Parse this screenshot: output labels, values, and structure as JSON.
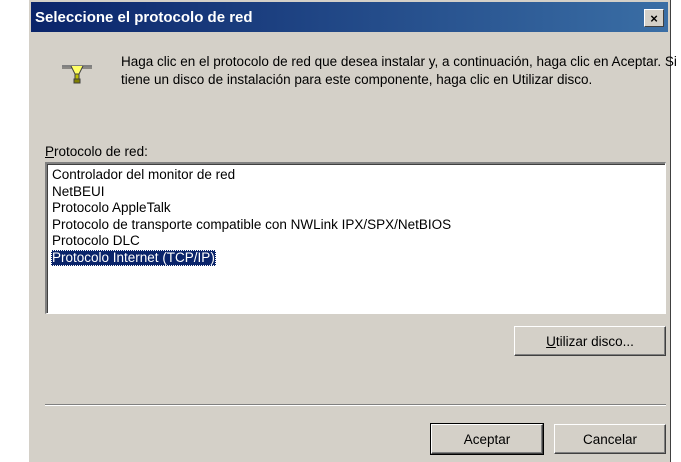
{
  "dialog": {
    "title": "Seleccione el protocolo de red",
    "close_label": "×",
    "instructions": "Haga clic en el protocolo de red que desea instalar y, a continuación, haga clic en Aceptar. Si tiene un disco de instalación para este componente, haga clic en Utilizar disco."
  },
  "list": {
    "label_first": "P",
    "label_rest": "rotocolo de red:",
    "items": [
      "Controlador del monitor de red",
      "NetBEUI",
      "Protocolo AppleTalk",
      "Protocolo de transporte compatible con NWLink IPX/SPX/NetBIOS",
      "Protocolo DLC",
      "Protocolo Internet (TCP/IP)"
    ],
    "selected_index": 5
  },
  "buttons": {
    "disk_first": "U",
    "disk_rest": "tilizar disco...",
    "ok": "Aceptar",
    "cancel": "Cancelar"
  },
  "colors": {
    "titlebar_start": "#0a246a",
    "titlebar_end": "#3a6ea5",
    "face": "#d4d0c8",
    "selection": "#0a246a"
  },
  "icons": {
    "protocol": "network-protocol-icon"
  }
}
